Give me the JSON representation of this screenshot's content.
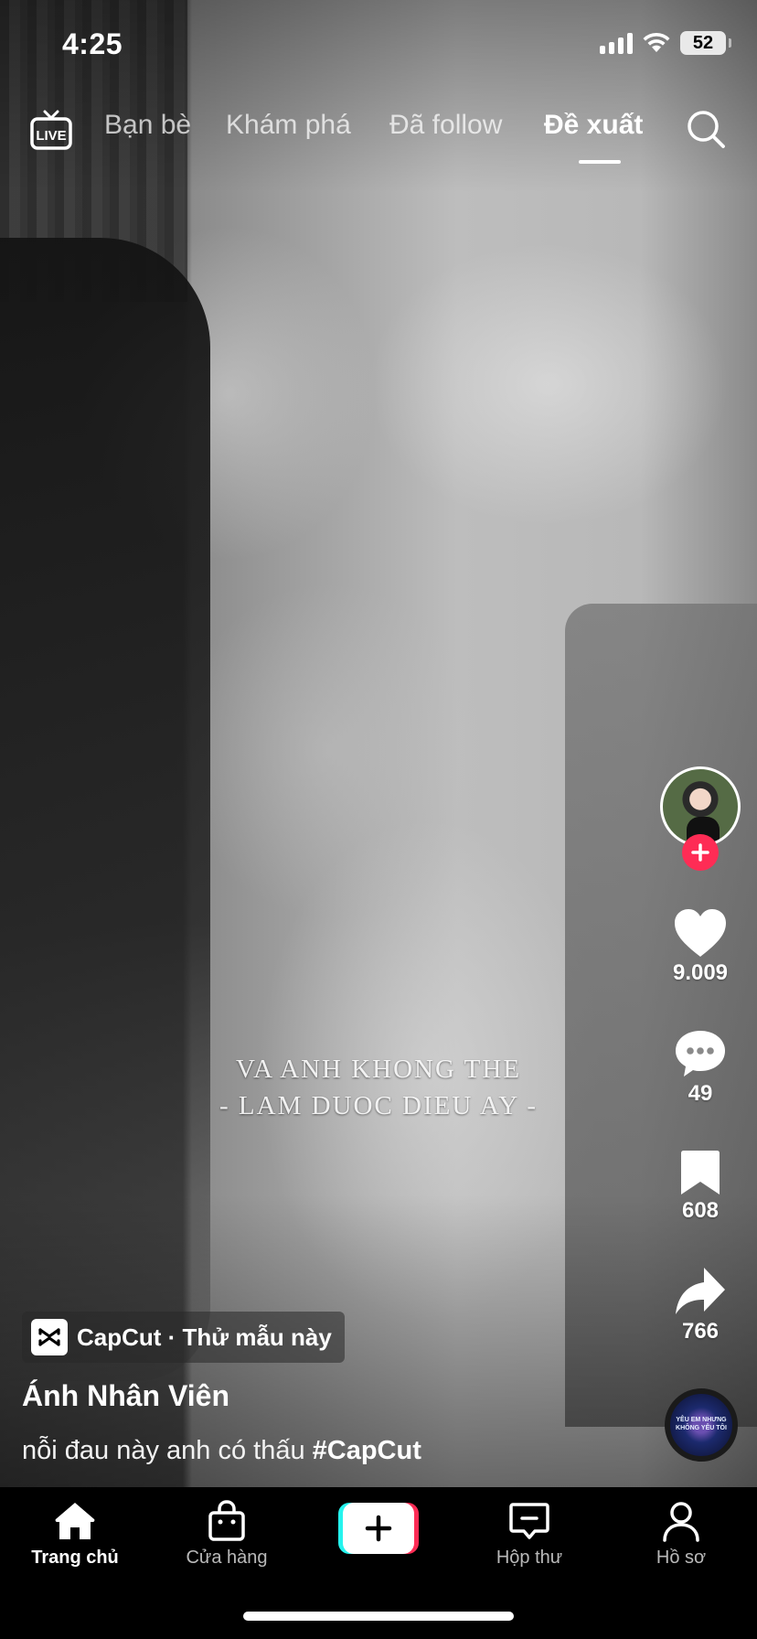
{
  "status_bar": {
    "time": "4:25",
    "battery": "52"
  },
  "top_nav": {
    "live_label": "LIVE",
    "tabs": [
      {
        "label": "Bạn bè"
      },
      {
        "label": "Khám phá"
      },
      {
        "label": "Đã follow"
      },
      {
        "label": "Đề xuất",
        "active": true
      }
    ]
  },
  "video": {
    "caption_line1": "VA ANH KHONG THE",
    "caption_line2": "- LAM DUOC DIEU AY -"
  },
  "actions": {
    "likes": "9.009",
    "comments": "49",
    "bookmarks": "608",
    "shares": "766"
  },
  "music_disc_text": "YÊU EM NHƯNG KHÔNG YÊU TÔI",
  "post": {
    "capcut_chip": "CapCut · Thử mẫu này",
    "username": "Ánh Nhân Viên",
    "description": "nỗi đau này anh có thấu ",
    "hashtag": "#CapCut"
  },
  "tabbar": {
    "home": "Trang chủ",
    "shop": "Cửa hàng",
    "inbox": "Hộp thư",
    "profile": "Hồ sơ"
  },
  "colors": {
    "accent_red": "#fe2c55",
    "accent_cyan": "#25f4ee",
    "tabbar_bg": "#000000"
  }
}
